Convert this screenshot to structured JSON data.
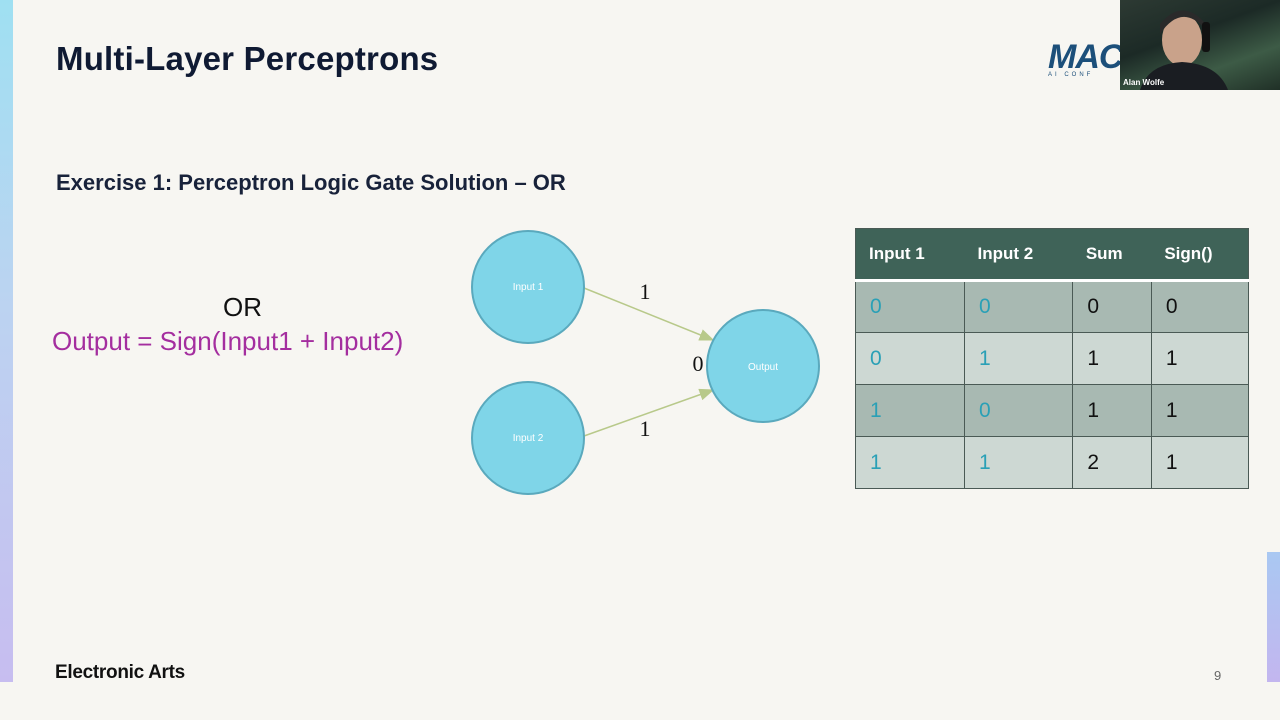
{
  "slide": {
    "title": "Multi-Layer Perceptrons",
    "subtitle": "Exercise 1: Perceptron Logic Gate Solution – OR",
    "gate_name": "OR",
    "formula": "Output = Sign(Input1 + Input2)",
    "footer_brand": "Electronic Arts",
    "page_number": "9"
  },
  "logo": {
    "text": "MAC",
    "subtext": "AI CONF"
  },
  "diagram": {
    "nodes": {
      "input1": "Input 1",
      "input2": "Input 2",
      "output": "Output"
    },
    "weights": {
      "input1": "1",
      "input2": "1",
      "bias": "0"
    },
    "colors": {
      "node_fill": "#7fd5e8",
      "node_stroke": "#5aa9bd",
      "edge": "#b8c98a"
    }
  },
  "table": {
    "headers": [
      "Input 1",
      "Input 2",
      "Sum",
      "Sign()"
    ],
    "rows": [
      [
        "0",
        "0",
        "0",
        "0"
      ],
      [
        "0",
        "1",
        "1",
        "1"
      ],
      [
        "1",
        "0",
        "1",
        "1"
      ],
      [
        "1",
        "1",
        "2",
        "1"
      ]
    ],
    "colors": {
      "header": "#3f6358",
      "row_dark": "#a8b9b2",
      "row_light": "#cdd8d3",
      "input_text": "#2aa0b6"
    }
  },
  "video": {
    "name": "Alan Wolfe"
  }
}
